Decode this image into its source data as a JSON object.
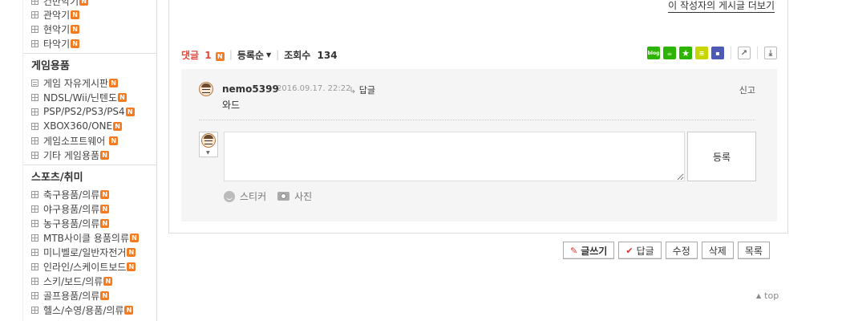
{
  "sidebar": {
    "group0": [
      {
        "label": "건반악기"
      },
      {
        "label": "관악기"
      },
      {
        "label": "현악기"
      },
      {
        "label": "타악기"
      }
    ],
    "sections": [
      {
        "title": "게임용품",
        "items": [
          {
            "label": "게임 자유게시판",
            "icon": "document-icon"
          },
          {
            "label": "NDSL/Wii/닌텐도",
            "icon": "grid-icon"
          },
          {
            "label": "PSP/PS2/PS3/PS4",
            "icon": "grid-icon"
          },
          {
            "label": "XBOX360/ONE",
            "icon": "grid-icon"
          },
          {
            "label": "게임소프트웨어",
            "icon": "grid-icon"
          },
          {
            "label": "기타 게임용품",
            "icon": "grid-icon"
          }
        ]
      },
      {
        "title": "스포츠/취미",
        "items": [
          {
            "label": "축구용품/의류"
          },
          {
            "label": "야구용품/의류"
          },
          {
            "label": "농구용품/의류"
          },
          {
            "label": "MTB사이클 용품의류"
          },
          {
            "label": "미니벨로/일반자전거"
          },
          {
            "label": "인라인/스케이트보드"
          },
          {
            "label": "스키/보드/의류"
          },
          {
            "label": "골프용품/의류"
          },
          {
            "label": "헬스/수영/용품/의류"
          }
        ]
      }
    ],
    "new_badge": "N"
  },
  "main": {
    "more_posts_link": "이 작성자의 게시글 더보기",
    "comment_bar": {
      "comment_label": "댓글",
      "comment_count": "1",
      "sort_label": "등록순",
      "views_label": "조회수",
      "views_count": "134"
    },
    "share_icons": [
      "blog-icon",
      "cafe-icon",
      "bookmark-star-icon",
      "band-icon",
      "memo-icon",
      "share-icon",
      "save-icon"
    ],
    "comments": [
      {
        "user": "nemo5399",
        "date": "2016.09.17. 22:22",
        "reply_label": "답글",
        "report_label": "신고",
        "text": "와드"
      }
    ],
    "write": {
      "placeholder": "",
      "submit_label": "등록",
      "sticker_label": "스티커",
      "photo_label": "사진"
    }
  },
  "actions": {
    "write_label": "글쓰기",
    "reply_label": "답글",
    "edit_label": "수정",
    "delete_label": "삭제",
    "list_label": "목록"
  },
  "top_link": "top",
  "colors": {
    "accent_red": "#e0483b",
    "badge_orange": "#f47b20",
    "naver_green": "#2db400",
    "comment_bg": "#f5f5f5"
  }
}
